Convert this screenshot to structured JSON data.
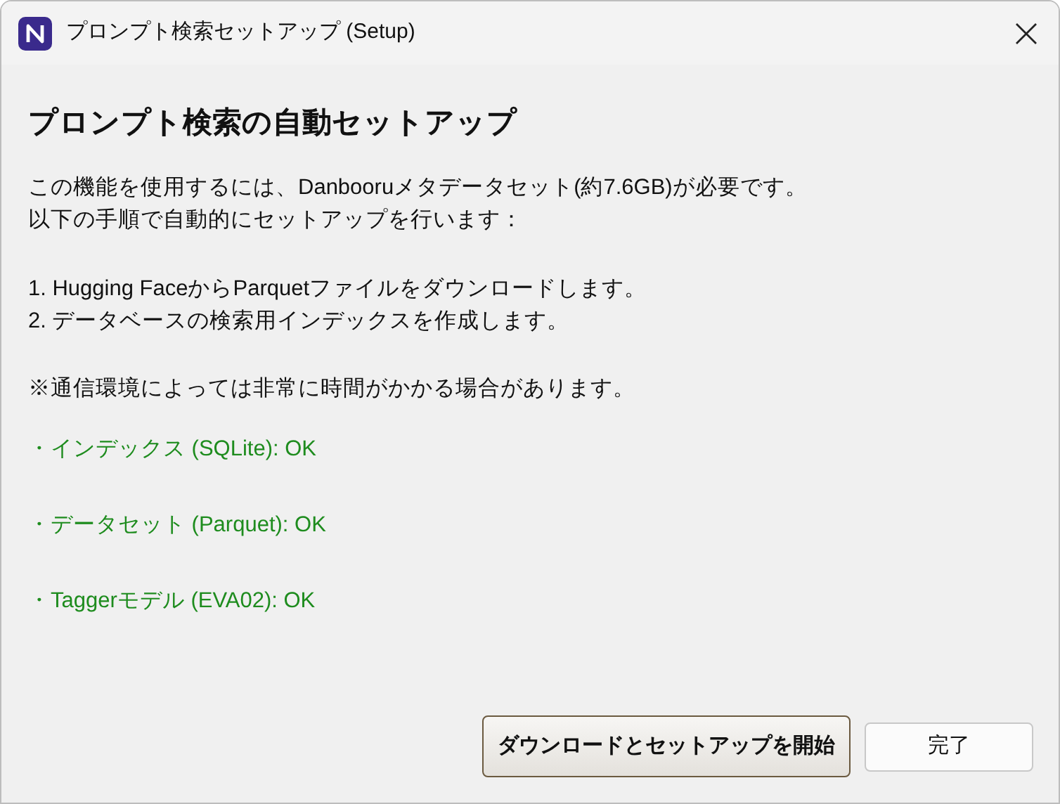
{
  "window": {
    "title": "プロンプト検索セットアップ (Setup)"
  },
  "heading": "プロンプト検索の自動セットアップ",
  "intro_lines": [
    "この機能を使用するには、Danbooruメタデータセット(約7.6GB)が必要です。",
    "以下の手順で自動的にセットアップを行います："
  ],
  "steps": [
    "1. Hugging FaceからParquetファイルをダウンロードします。",
    "2. データベースの検索用インデックスを作成します。"
  ],
  "note": "※通信環境によっては非常に時間がかかる場合があります。",
  "statuses": [
    {
      "text": "・インデックス (SQLite): OK",
      "kind": "ok"
    },
    {
      "text": "・データセット (Parquet): OK",
      "kind": "ok"
    },
    {
      "text": "・Taggerモデル (EVA02): OK",
      "kind": "ok"
    }
  ],
  "buttons": [
    {
      "label": "ダウンロードとセットアップを開始",
      "kind": "default"
    },
    {
      "label": "完了",
      "kind": "normal"
    }
  ]
}
